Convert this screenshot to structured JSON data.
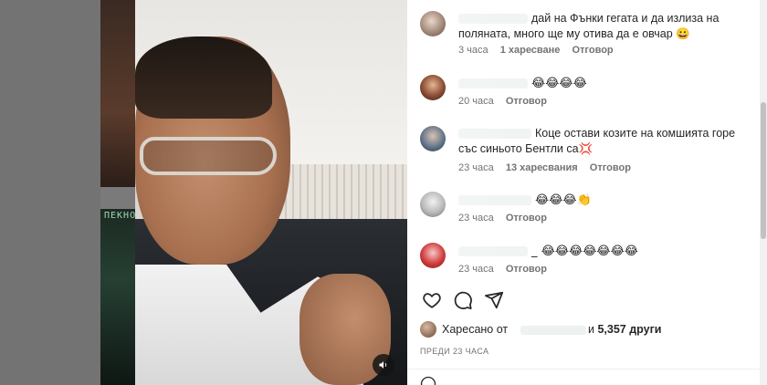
{
  "video": {
    "left_tag": "ПЕКНО",
    "mute_icon": "speaker-icon"
  },
  "comments": [
    {
      "text": "дай на Фънки гегата и да излиза на поляната, много ще му отива да е овчар 😀",
      "time": "3 часа",
      "likes": "1 харесване",
      "reply": "Отговор"
    },
    {
      "text": "😂😂😂😂",
      "time": "20 часа",
      "reply": "Отговор"
    },
    {
      "text": "Коце остави козите на комшията горе със синьото Бентли са💢",
      "time": "23 часа",
      "likes": "13 харесвания",
      "reply": "Отговор"
    },
    {
      "text": "😂😂😂👏",
      "time": "23 часа",
      "reply": "Отговор"
    },
    {
      "text": "_ 😂😂😂😂😂😂😂",
      "time": "23 часа",
      "reply": "Отговор"
    }
  ],
  "actions": {
    "like_icon": "heart-icon",
    "comment_icon": "comment-icon",
    "share_icon": "send-icon"
  },
  "likes": {
    "prefix": "Харесано от",
    "middle": "и",
    "count": "5,357 други"
  },
  "posted": "ПРЕДИ 23 ЧАСА",
  "colors": {
    "text": "#262626",
    "secondary": "#737373",
    "panel_bg": "#ffffff"
  }
}
